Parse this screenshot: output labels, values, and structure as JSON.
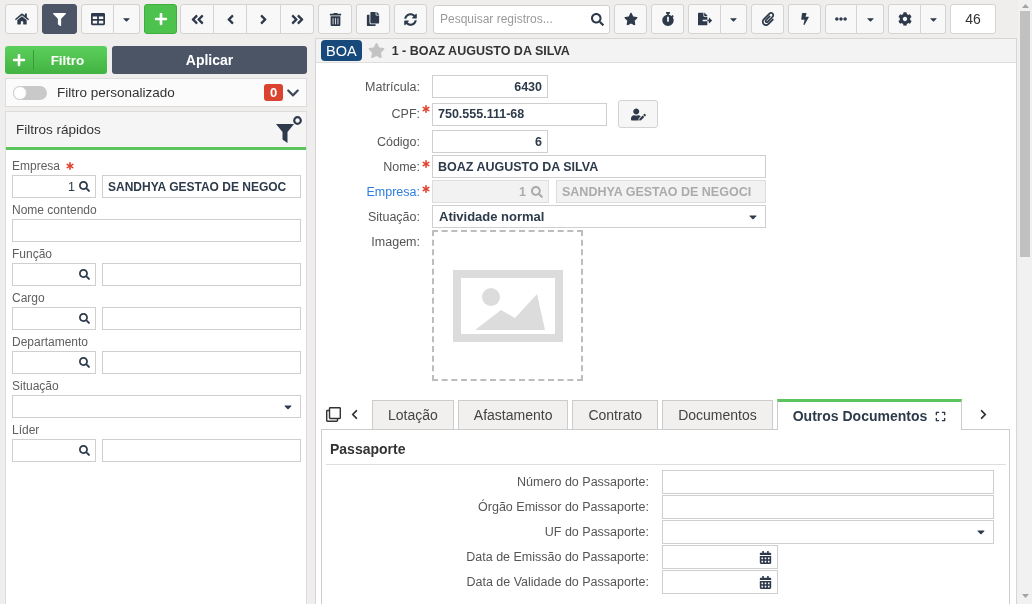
{
  "toolbar": {
    "filter_active": true,
    "search": {
      "placeholder": "Pesquisar registros..."
    },
    "record_count": "46"
  },
  "filter_actions": {
    "add_label": "Filtro",
    "apply_label": "Aplicar"
  },
  "custom_filter": {
    "label": "Filtro personalizado",
    "on": false,
    "count": "0"
  },
  "quick_filters": {
    "title": "Filtros rápidos",
    "fields": [
      {
        "kind": "lookup",
        "label": "Empresa",
        "required": true,
        "code": "1",
        "description": "SANDHYA GESTAO DE NEGOC"
      },
      {
        "kind": "text",
        "label": "Nome contendo",
        "required": false
      },
      {
        "kind": "lookup",
        "label": "Função",
        "required": false
      },
      {
        "kind": "lookup",
        "label": "Cargo",
        "required": false
      },
      {
        "kind": "lookup",
        "label": "Departamento",
        "required": false
      },
      {
        "kind": "select",
        "label": "Situação",
        "required": false
      },
      {
        "kind": "lookup",
        "label": "Líder",
        "required": false
      }
    ]
  },
  "record": {
    "badge": "BOA",
    "favorite": false,
    "title": "1 - BOAZ AUGUSTO DA SILVA",
    "fields": [
      {
        "kind": "number",
        "label": "Matrícula:",
        "value": "6430",
        "required": false,
        "disabled": false,
        "link": false
      },
      {
        "kind": "document",
        "label": "CPF:",
        "value": "750.555.111-68",
        "required": true,
        "disabled": false,
        "link": false
      },
      {
        "kind": "number",
        "label": "Código:",
        "value": "6",
        "required": false,
        "disabled": false,
        "link": false
      },
      {
        "kind": "text",
        "label": "Nome:",
        "value": "BOAZ AUGUSTO DA SILVA",
        "required": true,
        "disabled": false,
        "link": false
      },
      {
        "kind": "lookup",
        "label": "Empresa:",
        "code": "1",
        "description": "SANDHYA GESTAO DE NEGOCI",
        "required": true,
        "disabled": true,
        "link": true
      },
      {
        "kind": "select",
        "label": "Situação:",
        "value": "Atividade normal",
        "required": false,
        "disabled": false,
        "link": false
      },
      {
        "kind": "image",
        "label": "Imagem:",
        "required": false,
        "disabled": false,
        "link": false
      }
    ]
  },
  "tabs": [
    {
      "label": "Lotação",
      "selected": false
    },
    {
      "label": "Afastamento",
      "selected": false
    },
    {
      "label": "Contrato",
      "selected": false
    },
    {
      "label": "Documentos",
      "selected": false
    },
    {
      "label": "Outros Documentos",
      "selected": true
    }
  ],
  "section": {
    "title": "Passaporte",
    "fields": [
      {
        "kind": "text",
        "label": "Número do Passaporte:"
      },
      {
        "kind": "text",
        "label": "Órgão Emissor do Passaporte:"
      },
      {
        "kind": "select",
        "label": "UF do Passaporte:"
      },
      {
        "kind": "date",
        "label": "Data de Emissão do Passaporte:"
      },
      {
        "kind": "date",
        "label": "Data de Validade do Passaporte:"
      }
    ]
  }
}
